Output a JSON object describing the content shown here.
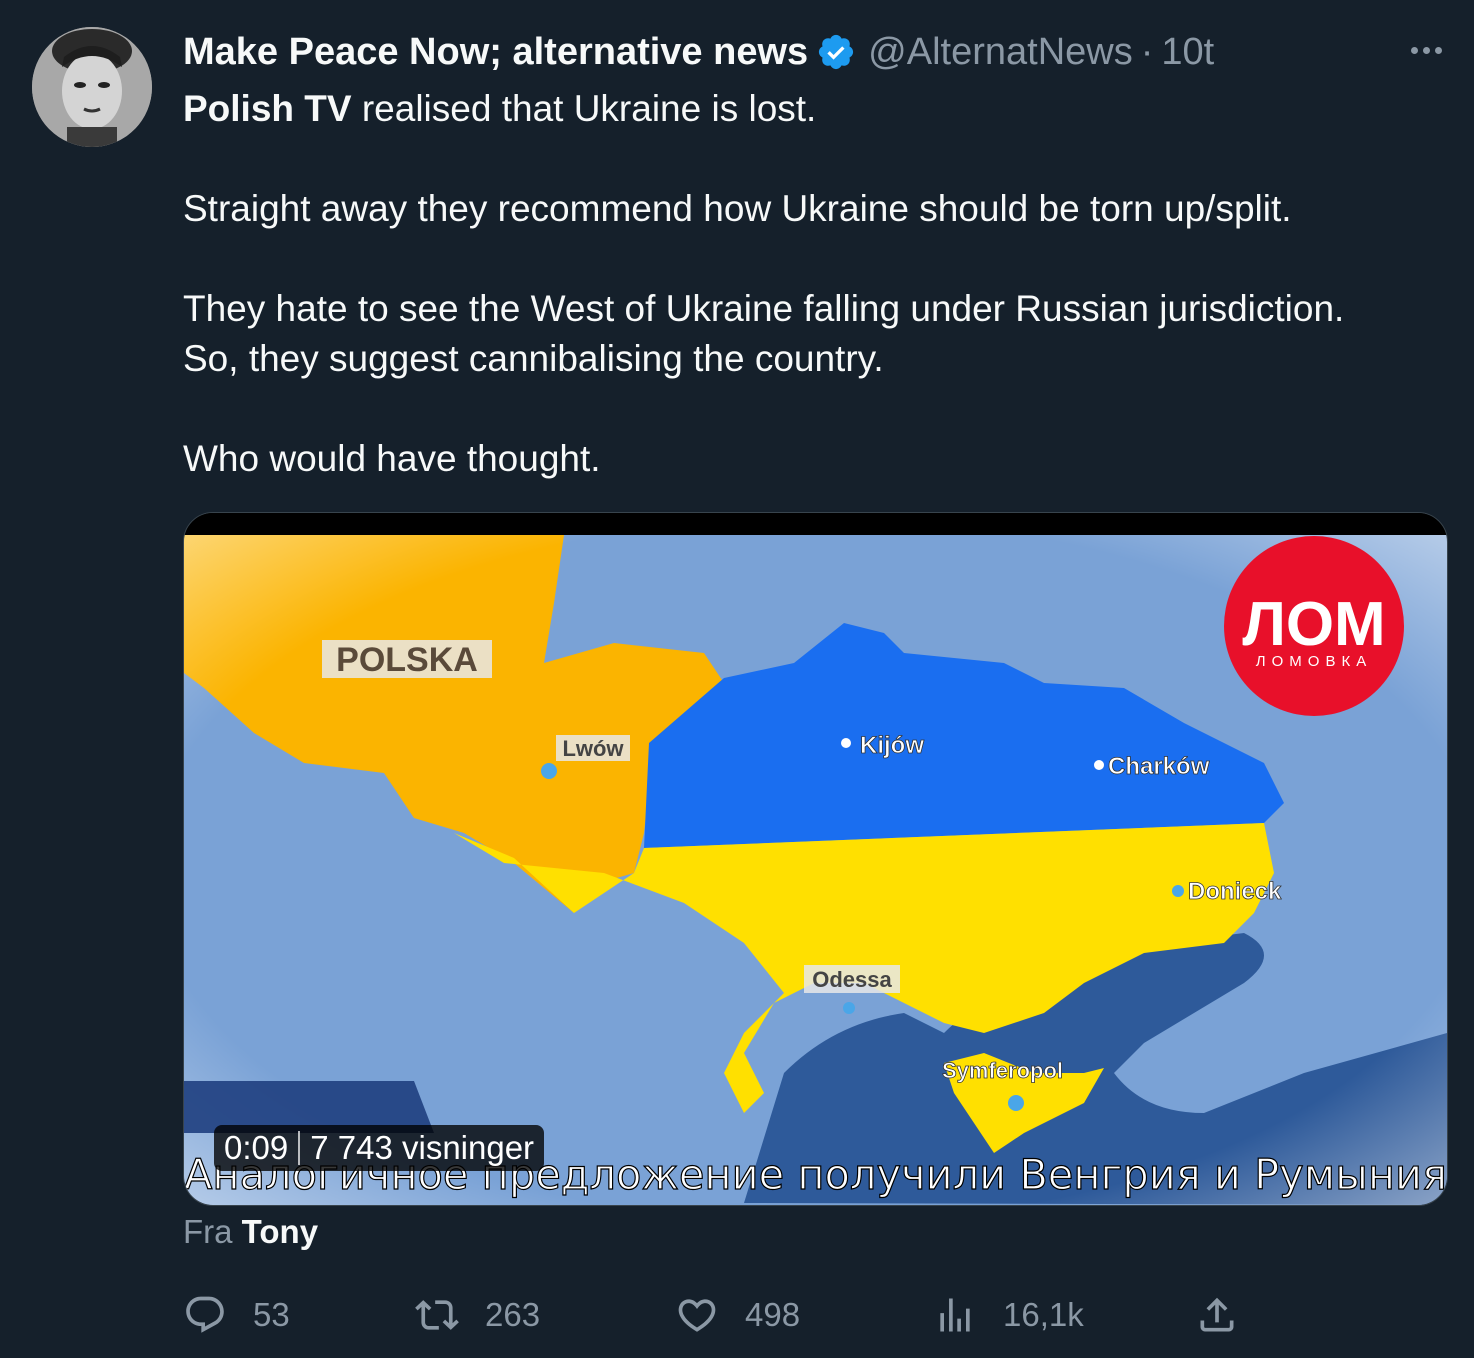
{
  "author": {
    "display_name": "Make Peace Now; alternative news",
    "handle": "@AlternatNews",
    "separator": "·",
    "time": "10t"
  },
  "tweet": {
    "line1_bold": "Polish TV",
    "line1_rest": " realised that Ukraine is lost.",
    "p2": "Straight away they recommend how Ukraine should be torn up/split.",
    "p3a": "They hate to see the West of Ukraine falling under Russian jurisdiction.",
    "p3b": "So, they suggest cannibalising the country.",
    "p4": "Who would have thought."
  },
  "media": {
    "map_labels": {
      "polska": "POLSKA",
      "lwow": "Lwów",
      "kijow": "Kijów",
      "charkow": "Charków",
      "donieck": "Donieck",
      "odessa": "Odessa",
      "symferopol": "Symferopol"
    },
    "logo_text": "ЛОМ",
    "logo_subtext": "ЛОМОВКА",
    "caption": "Аналогичное предложение получили Венгрия и Румыния",
    "duration": "0:09",
    "views": "7 743 visninger",
    "colors": {
      "west_orange": "#fbb400",
      "center_blue": "#1a6ef0",
      "south_yellow": "#ffe000",
      "land_gray": "#7aa2d6",
      "sea": "#2e5a9a",
      "logo_red": "#e8102a"
    }
  },
  "source": {
    "prefix": "Fra ",
    "name": "Tony"
  },
  "actions": {
    "replies": "53",
    "retweets": "263",
    "likes": "498",
    "views": "16,1k"
  },
  "icons": {
    "verified": "verified-badge-icon",
    "more": "more-options-icon",
    "reply": "reply-icon",
    "retweet": "retweet-icon",
    "like": "like-icon",
    "views": "views-icon",
    "share": "share-icon"
  }
}
